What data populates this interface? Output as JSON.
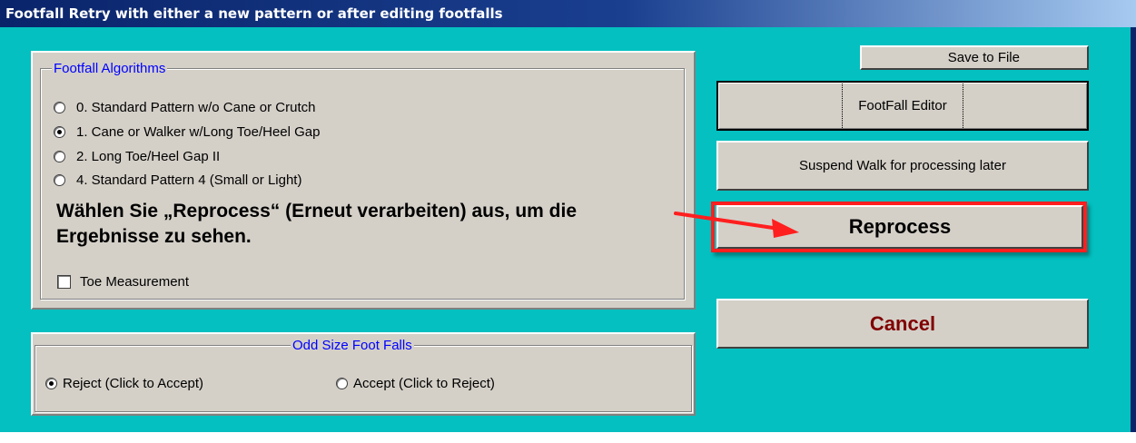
{
  "window": {
    "title": "Footfall Retry with either a new pattern or after editing footfalls"
  },
  "algorithms": {
    "legend": "Footfall Algorithms",
    "options": [
      {
        "label": "0. Standard Pattern w/o Cane or Crutch",
        "checked": false
      },
      {
        "label": "1.  Cane or Walker w/Long Toe/Heel Gap",
        "checked": true
      },
      {
        "label": "2.  Long Toe/Heel Gap II",
        "checked": false
      },
      {
        "label": "4. Standard Pattern 4 (Small or Light)",
        "checked": false
      }
    ],
    "toe_measurement": {
      "label": "Toe Measurement",
      "checked": false
    }
  },
  "odd_size": {
    "legend": "Odd Size Foot Falls",
    "reject_label": "Reject (Click to Accept)",
    "accept_label": "Accept (Click to Reject)",
    "selected": "reject"
  },
  "buttons": {
    "save_to_file": "Save to File",
    "footfall_editor": "FootFall Editor",
    "suspend_walk": "Suspend Walk for processing later",
    "reprocess": "Reprocess",
    "cancel": "Cancel"
  },
  "annotation": {
    "text": "Wählen Sie „Reprocess“ (Erneut verarbeiten) aus, um die Ergebnisse zu sehen.",
    "arrow_color": "#ff1f1f"
  },
  "colors": {
    "background": "#04c0c0",
    "panel": "#d4d0c8",
    "legend_text": "#0000ff",
    "cancel_text": "#800000",
    "title_bar": "#0a246a"
  }
}
